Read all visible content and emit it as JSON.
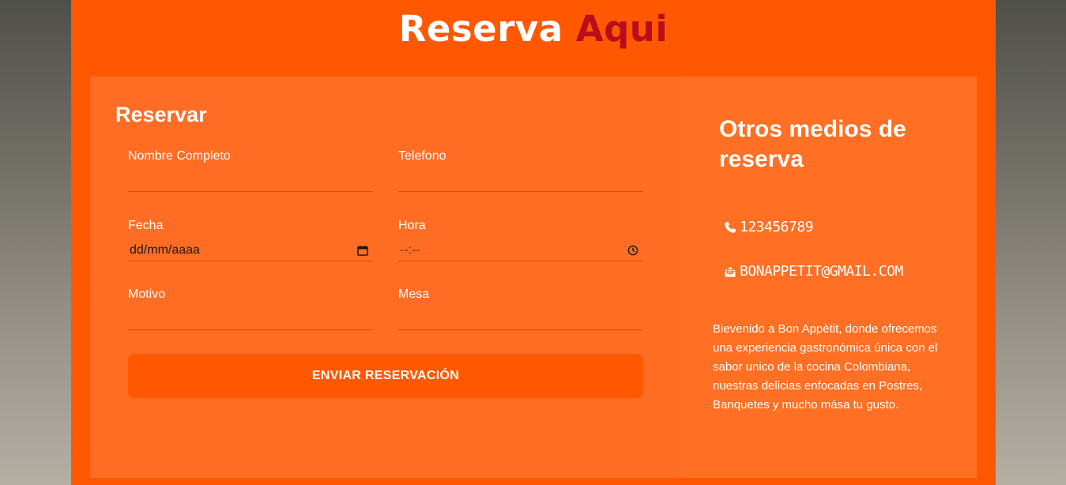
{
  "header": {
    "title_main": "Reserva",
    "title_accent": "Aqui",
    "accent_color": "#b80e1c",
    "page_color": "#ff5800"
  },
  "form": {
    "title": "Reservar",
    "fields": {
      "nombre": {
        "label": "Nombre Completo",
        "value": ""
      },
      "telefono": {
        "label": "Telefono",
        "value": ""
      },
      "fecha": {
        "label": "Fecha",
        "placeholder": "dd/mm/aaaa",
        "icon": "calendar-icon"
      },
      "hora": {
        "label": "Hora",
        "placeholder": "--:--",
        "icon": "clock-icon"
      },
      "motivo": {
        "label": "Motivo",
        "value": ""
      },
      "mesa": {
        "label": "Mesa",
        "value": ""
      }
    },
    "submit_label": "ENVIAR RESERVACIÓN"
  },
  "sidebar": {
    "title": "Otros medios de reserva",
    "phone": {
      "icon": "phone-icon",
      "text": "123456789"
    },
    "email": {
      "icon": "envelope-open-icon",
      "text": "BONAPPETIT@GMAIL.COM"
    },
    "description": "Bievenido a Bon Appètit, donde ofrecemos una experiencia gastronómica única con el sabor unico de la cocina Colombiana, nuestras delicias enfocadas en Postres, Banquetes y mucho mása tu gusto."
  }
}
